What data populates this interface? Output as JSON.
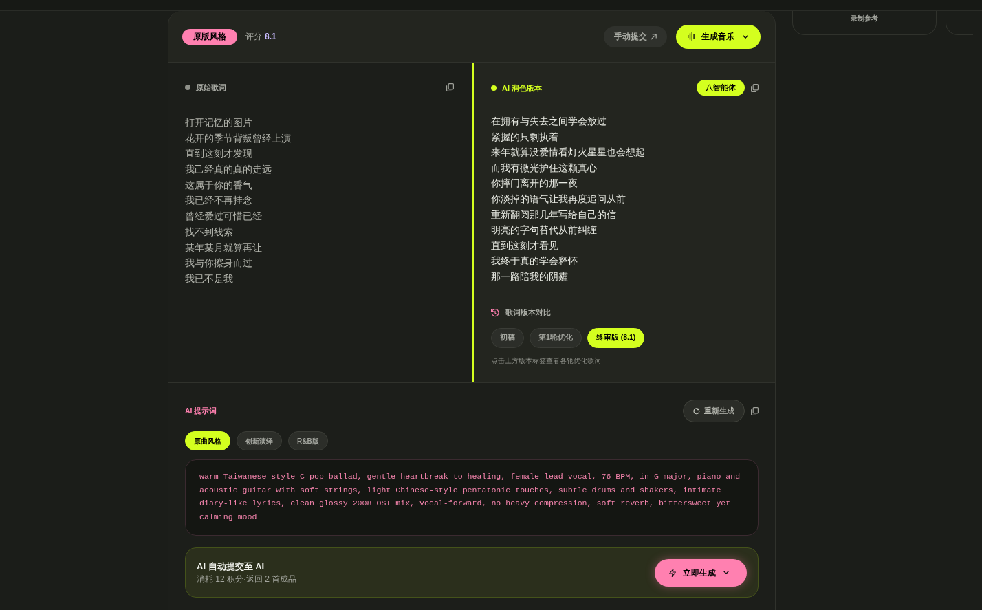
{
  "header": {
    "style_badge": "原版风格",
    "score_label": "评分",
    "score_value": "8.1",
    "manual_submit": "手动提交",
    "generate_music": "生成音乐"
  },
  "original_lyrics": {
    "title": "原始歌词",
    "lines": [
      "打开记忆的图片",
      "花开的季节背叛曾经上演",
      "直到这刻才发现",
      "我己经真的真的走远",
      "这属于你的香气",
      "我已经不再挂念",
      "曾经爱过可惜已经",
      "找不到线索",
      "某年某月就算再让",
      "我与你擦身而过",
      "我已不是我"
    ]
  },
  "polished_lyrics": {
    "title": "AI 润色版本",
    "agent_badge": "八智能体",
    "lines": [
      "在拥有与失去之间学会放过",
      "紧握的只剩执着",
      "来年就算没爱情看灯火星星也会想起",
      "而我有微光护住这颗真心",
      "你摔门离开的那一夜",
      "你淡掉的语气让我再度追问从前",
      "重新翻阅那几年写给自己的信",
      "明亮的字句替代从前纠缠",
      "直到这刻才看见",
      "我终于真的学会释怀",
      "那一路陪我的阴霾"
    ]
  },
  "version_compare": {
    "title": "歌词版本对比",
    "versions": [
      {
        "label": "初稿",
        "selected": false
      },
      {
        "label": "第1轮优化",
        "selected": false
      },
      {
        "label": "终审版 (8.1)",
        "selected": true
      }
    ],
    "hint": "点击上方版本标签查看各轮优化歌词"
  },
  "prompt": {
    "title": "AI 提示词",
    "regenerate": "重新生成",
    "styles": [
      {
        "label": "原曲风格",
        "selected": true
      },
      {
        "label": "创新演绎",
        "selected": false
      },
      {
        "label": "R&B版",
        "selected": false
      }
    ],
    "text": "warm Taiwanese-style C-pop ballad, gentle heartbreak to healing, female lead vocal, 76 BPM, in G major, piano and acoustic guitar with soft strings, light Chinese-style pentatonic touches, subtle drums and shakers, intimate diary-like lyrics, clean glossy 2008 OST mix, vocal-forward, no heavy compression, soft reverb, bittersweet yet calming mood"
  },
  "auto_submit": {
    "title": "AI 自动提交至 AI",
    "subtitle": "消耗 12 积分·返回 2 首成品",
    "button": "立即生成"
  },
  "side_cards": [
    {
      "label": "录制参考"
    }
  ]
}
